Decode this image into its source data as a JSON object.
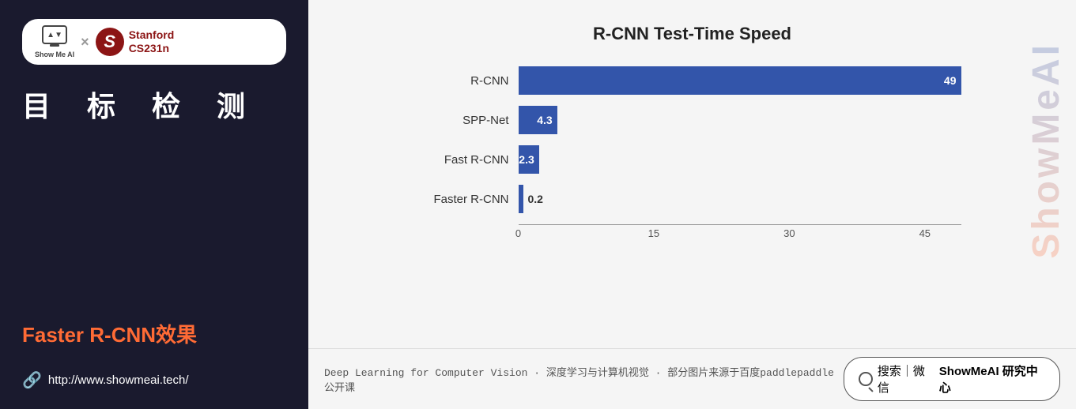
{
  "left": {
    "showmeai_label": "Show Me AI",
    "cross": "×",
    "stanford_s": "S",
    "stanford_name": "Stanford",
    "stanford_course": "CS231n",
    "page_title": "目 标 检 测",
    "subtitle": "Faster R-CNN效果",
    "website": "http://www.showmeai.tech/"
  },
  "chart": {
    "title": "R-CNN Test-Time Speed",
    "bars": [
      {
        "label": "R-CNN",
        "value": 49,
        "max": 49,
        "display": "49"
      },
      {
        "label": "SPP-Net",
        "value": 4.3,
        "max": 49,
        "display": "4.3"
      },
      {
        "label": "Fast R-CNN",
        "value": 2.3,
        "max": 49,
        "display": "2.3"
      },
      {
        "label": "Faster R-CNN",
        "value": 0.2,
        "max": 49,
        "display": "0.2"
      }
    ],
    "x_ticks": [
      "0",
      "15",
      "30",
      "45"
    ]
  },
  "watermark": "ShowMeAI",
  "bottom": {
    "description": "Deep Learning for Computer Vision · 深度学习与计算机视觉 · 部分图片来源于百度paddlepaddle公开课",
    "search_label": "搜索｜微信",
    "brand": "ShowMeAI 研究中心"
  }
}
